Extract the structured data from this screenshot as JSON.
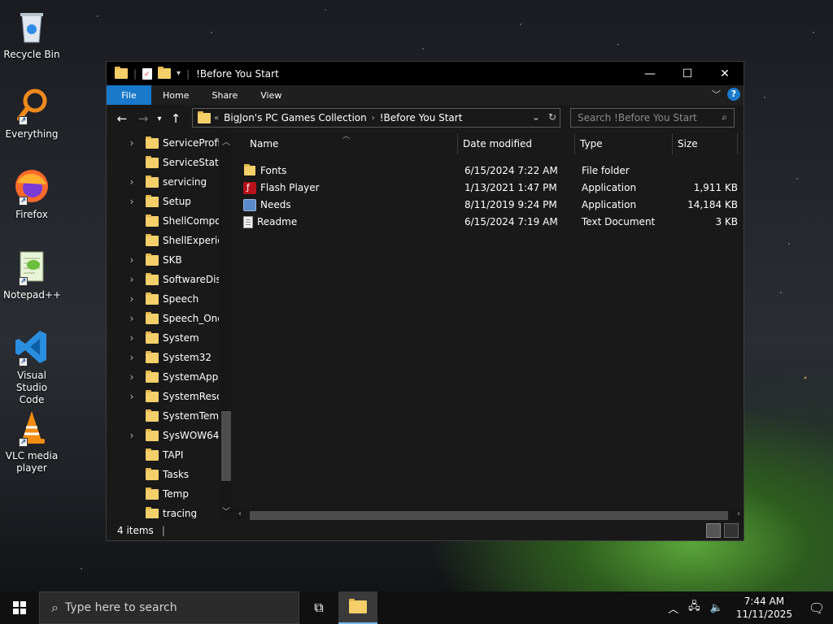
{
  "desktop": {
    "icons": [
      {
        "label": "Recycle Bin",
        "icon": "recycle-bin-icon"
      },
      {
        "label": "Everything",
        "icon": "everything-search-icon"
      },
      {
        "label": "Firefox",
        "icon": "firefox-icon"
      },
      {
        "label": "Notepad++",
        "icon": "notepadpp-icon"
      },
      {
        "label": "Visual Studio Code",
        "icon": "vscode-icon"
      },
      {
        "label": "VLC media player",
        "icon": "vlc-icon"
      }
    ]
  },
  "window": {
    "title": "!Before You Start",
    "controls": {
      "minimize": "—",
      "maximize": "☐",
      "close": "✕"
    },
    "ribbon_tabs": [
      "File",
      "Home",
      "Share",
      "View"
    ],
    "help": "?",
    "address": {
      "prefix": "«",
      "crumbs": [
        "BigJon's PC Games Collection",
        "!Before You Start"
      ]
    },
    "search_placeholder": "Search !Before You Start",
    "nav_tree": [
      {
        "label": "ServiceProfile",
        "expandable": true
      },
      {
        "label": "ServiceState",
        "expandable": false
      },
      {
        "label": "servicing",
        "expandable": true
      },
      {
        "label": "Setup",
        "expandable": true
      },
      {
        "label": "ShellCompor",
        "expandable": false
      },
      {
        "label": "ShellExperien",
        "expandable": false
      },
      {
        "label": "SKB",
        "expandable": true
      },
      {
        "label": "SoftwareDistr",
        "expandable": true
      },
      {
        "label": "Speech",
        "expandable": true
      },
      {
        "label": "Speech_OneC",
        "expandable": true
      },
      {
        "label": "System",
        "expandable": true
      },
      {
        "label": "System32",
        "expandable": true
      },
      {
        "label": "SystemApps",
        "expandable": true
      },
      {
        "label": "SystemResou",
        "expandable": true
      },
      {
        "label": "SystemTemp",
        "expandable": false
      },
      {
        "label": "SysWOW64",
        "expandable": true
      },
      {
        "label": "TAPI",
        "expandable": false
      },
      {
        "label": "Tasks",
        "expandable": false
      },
      {
        "label": "Temp",
        "expandable": false
      },
      {
        "label": "tracing",
        "expandable": false
      }
    ],
    "columns": {
      "name": "Name",
      "date": "Date modified",
      "type": "Type",
      "size": "Size"
    },
    "files": [
      {
        "name": "Fonts",
        "date": "6/15/2024 7:22 AM",
        "type": "File folder",
        "size": "",
        "icon": "folder-icon"
      },
      {
        "name": "Flash Player",
        "date": "1/13/2021 1:47 PM",
        "type": "Application",
        "size": "1,911 KB",
        "icon": "flash-player-icon"
      },
      {
        "name": "Needs",
        "date": "8/11/2019 9:24 PM",
        "type": "Application",
        "size": "14,184 KB",
        "icon": "application-icon"
      },
      {
        "name": "Readme",
        "date": "6/15/2024 7:19 AM",
        "type": "Text Document",
        "size": "3 KB",
        "icon": "text-document-icon"
      }
    ],
    "status": "4 items"
  },
  "taskbar": {
    "search_placeholder": "Type here to search",
    "time": "7:44 AM",
    "date": "11/11/2025"
  }
}
